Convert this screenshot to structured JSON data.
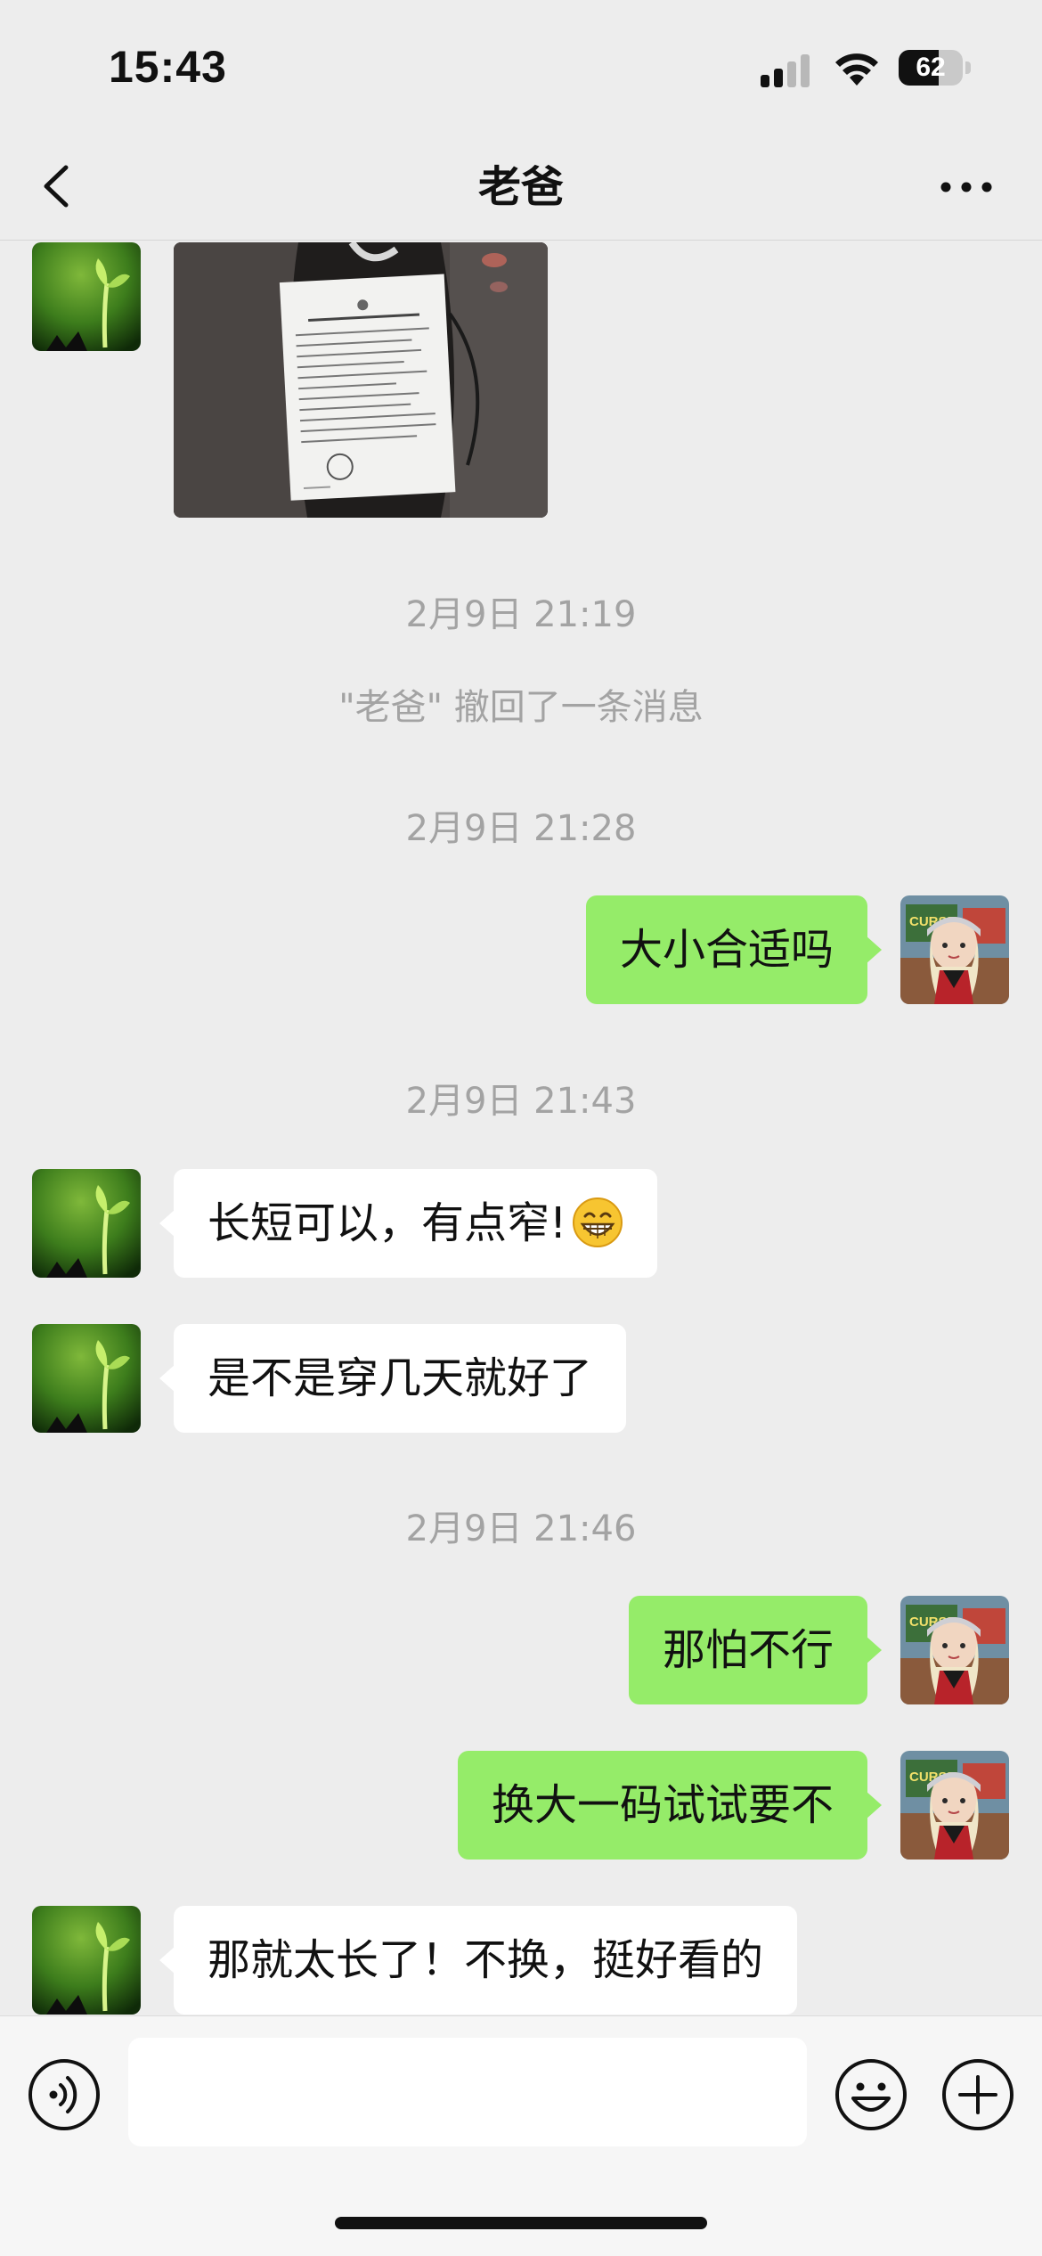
{
  "status_bar": {
    "time": "15:43",
    "battery_level": "62",
    "battery_fraction": 0.62,
    "icons": [
      "cellular-signal-icon",
      "wifi-icon",
      "battery-icon"
    ]
  },
  "nav": {
    "title": "老爸",
    "back_icon": "chevron-left-icon",
    "more_icon": "more-dots-icon"
  },
  "messages": [
    {
      "type": "image",
      "side": "left",
      "sender": "老爸",
      "content": "product-tag-photo"
    },
    {
      "type": "timestamp",
      "text": "2月9日 21:19"
    },
    {
      "type": "system",
      "text": "\"老爸\" 撤回了一条消息"
    },
    {
      "type": "timestamp",
      "text": "2月9日 21:28"
    },
    {
      "type": "text",
      "side": "right",
      "text": "大小合适吗"
    },
    {
      "type": "timestamp",
      "text": "2月9日 21:43"
    },
    {
      "type": "text",
      "side": "left",
      "text": "长短可以，有点窄!",
      "emoji": "grinning-face-icon"
    },
    {
      "type": "text",
      "side": "left",
      "text": "是不是穿几天就好了"
    },
    {
      "type": "timestamp",
      "text": "2月9日 21:46"
    },
    {
      "type": "text",
      "side": "right",
      "text": "那怕不行"
    },
    {
      "type": "text",
      "side": "right",
      "text": "换大一码试试要不"
    },
    {
      "type": "text",
      "side": "left",
      "text": "那就太长了！不换，挺好看的"
    }
  ],
  "input_bar": {
    "value": "",
    "icons": [
      "voice-icon",
      "emoji-icon",
      "plus-icon"
    ]
  },
  "colors": {
    "background": "#ededed",
    "sent_bubble": "#95ec69",
    "received_bubble": "#ffffff",
    "timestamp_text": "#a3a3a3"
  }
}
